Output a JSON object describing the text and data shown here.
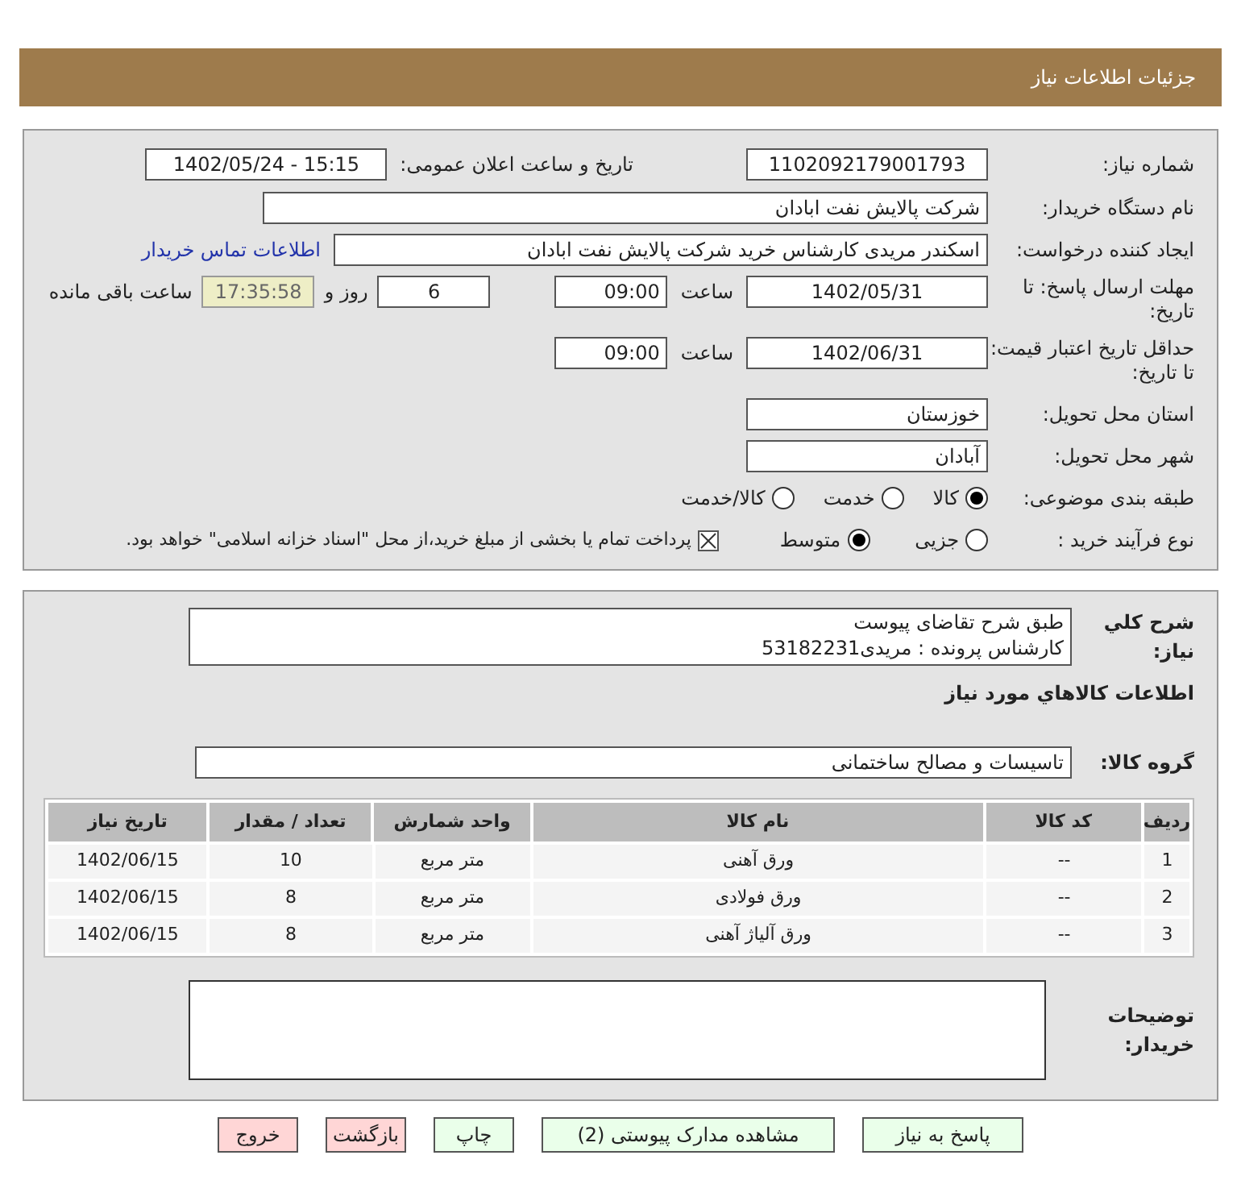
{
  "header": {
    "title": "جزئیات اطلاعات نیاز"
  },
  "need_number": {
    "label": "شماره نیاز:",
    "value": "1102092179001793"
  },
  "announce": {
    "label": "تاریخ و ساعت اعلان عمومی:",
    "value": "1402/05/24 - 15:15"
  },
  "buyer_org": {
    "label": "نام دستگاه خریدار:",
    "value": "شرکت پالایش نفت ابادان"
  },
  "requester": {
    "label": "ایجاد کننده درخواست:",
    "value": "اسکندر مریدی کارشناس خرید شرکت پالایش نفت ابادان",
    "link": "اطلاعات تماس خریدار"
  },
  "reply_deadline": {
    "label": "مهلت ارسال پاسخ: تا تاریخ:",
    "date": "1402/05/31",
    "time_label": "ساعت",
    "time": "09:00",
    "days": "6",
    "days_label": "روز و",
    "remaining": "17:35:58",
    "remaining_label": "ساعت باقی مانده"
  },
  "price_validity": {
    "label": "حداقل تاریخ اعتبار قیمت: تا تاریخ:",
    "date": "1402/06/31",
    "time_label": "ساعت",
    "time": "09:00"
  },
  "province": {
    "label": "استان محل تحویل:",
    "value": "خوزستان"
  },
  "city": {
    "label": "شهر محل تحویل:",
    "value": "آبادان"
  },
  "category": {
    "label": "طبقه بندی موضوعی:",
    "options": [
      {
        "label": "کالا",
        "selected": true
      },
      {
        "label": "خدمت",
        "selected": false
      },
      {
        "label": "کالا/خدمت",
        "selected": false
      }
    ]
  },
  "process": {
    "label": "نوع فرآیند خرید :",
    "options": [
      {
        "label": "جزیی",
        "selected": false
      },
      {
        "label": "متوسط",
        "selected": true
      }
    ],
    "payment": {
      "checked": true,
      "text": "پرداخت تمام یا بخشی از مبلغ خرید،از محل \"اسناد خزانه اسلامی\" خواهد بود."
    }
  },
  "description": {
    "label": "شرح كلي نياز:",
    "lines": [
      "طبق شرح تقاضای پیوست",
      "کارشناس پرونده : مریدی53182231"
    ]
  },
  "goods_title": "اطلاعات كالاهاي مورد نياز",
  "goods_group": {
    "label": "گروه کالا:",
    "value": "تاسیسات و مصالح ساختمانی"
  },
  "table": {
    "columns": [
      "ردیف",
      "کد کالا",
      "نام کالا",
      "واحد شمارش",
      "تعداد / مقدار",
      "تاریخ نیاز"
    ],
    "rows": [
      [
        "1",
        "--",
        "ورق آهنی",
        "متر مربع",
        "10",
        "1402/06/15"
      ],
      [
        "2",
        "--",
        "ورق فولادی",
        "متر مربع",
        "8",
        "1402/06/15"
      ],
      [
        "3",
        "--",
        "ورق آلیاژ آهنی",
        "متر مربع",
        "8",
        "1402/06/15"
      ]
    ]
  },
  "buyer_notes": {
    "label": "توضیحات خریدار:"
  },
  "buttons": [
    {
      "label": "پاسخ به نیاز",
      "kind": "normal"
    },
    {
      "label": "مشاهده مدارک پیوستی (2)",
      "kind": "normal"
    },
    {
      "label": "چاپ",
      "kind": "normal"
    },
    {
      "label": "بازگشت",
      "kind": "danger"
    },
    {
      "label": "خروج",
      "kind": "danger"
    }
  ]
}
